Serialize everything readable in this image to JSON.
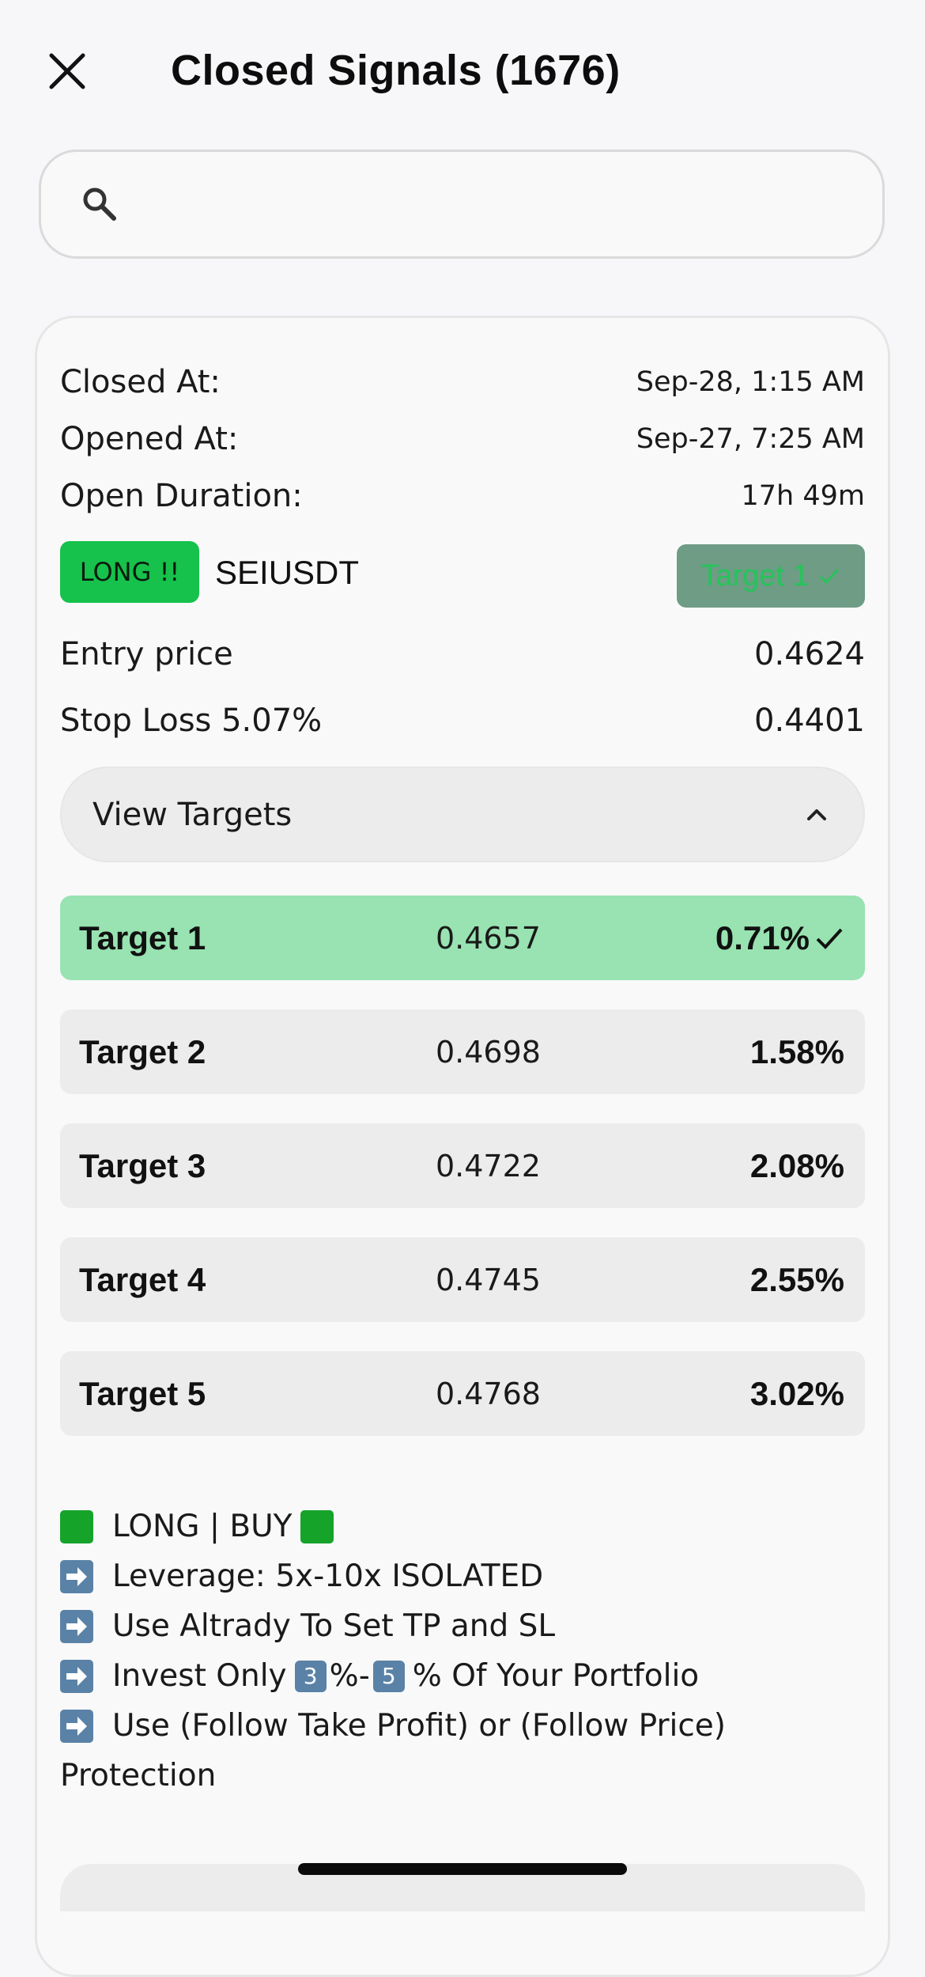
{
  "header": {
    "title": "Closed Signals (1676)"
  },
  "search": {
    "placeholder": "",
    "value": ""
  },
  "signal": {
    "closed_at_label": "Closed At:",
    "closed_at_value": "Sep-28, 1:15 AM",
    "opened_at_label": "Opened At:",
    "opened_at_value": "Sep-27, 7:25 AM",
    "duration_label": "Open Duration:",
    "duration_value": "17h 49m",
    "direction_badge": "LONG !!",
    "pair": "SEIUSDT",
    "status_label": "Target 1",
    "entry_label": "Entry price",
    "entry_value": "0.4624",
    "stop_loss_label": "Stop Loss 5.07%",
    "stop_loss_value": "0.4401",
    "view_targets_label": "View Targets",
    "targets": [
      {
        "name": "Target 1",
        "price": "0.4657",
        "percent": "0.71%",
        "hit": true
      },
      {
        "name": "Target 2",
        "price": "0.4698",
        "percent": "1.58%",
        "hit": false
      },
      {
        "name": "Target 3",
        "price": "0.4722",
        "percent": "2.08%",
        "hit": false
      },
      {
        "name": "Target 4",
        "price": "0.4745",
        "percent": "2.55%",
        "hit": false
      },
      {
        "name": "Target 5",
        "price": "0.4768",
        "percent": "3.02%",
        "hit": false
      }
    ],
    "description": {
      "line1": "LONG | BUY",
      "line2": "Leverage: 5x-10x ISOLATED",
      "line3": "Use Altrady To Set TP and SL",
      "line4_prefix": "Invest Only",
      "line4_key1": "3",
      "line4_mid": "%-",
      "line4_key2": "5",
      "line4_suffix": "% Of Your Portfolio",
      "line5": "Use (Follow Take Profit) or (Follow Price)",
      "line6": "Protection"
    }
  },
  "colors": {
    "long_green": "#16c24b",
    "target_hit_bg": "#98e3b1",
    "status_bg": "#6e9c85",
    "status_text": "#25c45a",
    "row_bg": "#ececed"
  }
}
